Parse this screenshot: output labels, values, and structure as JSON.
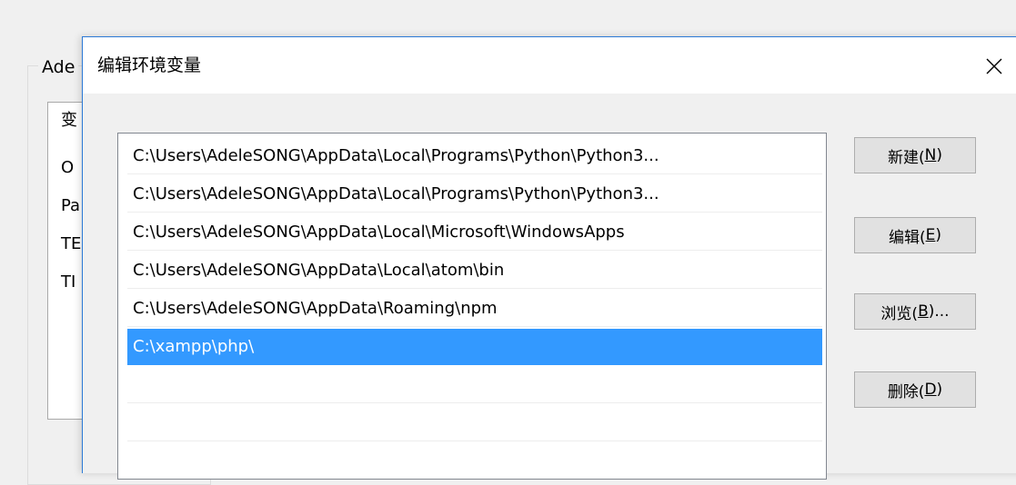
{
  "background": {
    "group_label": "Ade",
    "list_items": [
      "变",
      "O",
      "Pa",
      "TE",
      "TI"
    ]
  },
  "dialog": {
    "title": "编辑环境变量",
    "paths": [
      "C:\\Users\\AdeleSONG\\AppData\\Local\\Programs\\Python\\Python3...",
      "C:\\Users\\AdeleSONG\\AppData\\Local\\Programs\\Python\\Python3...",
      "C:\\Users\\AdeleSONG\\AppData\\Local\\Microsoft\\WindowsApps",
      "C:\\Users\\AdeleSONG\\AppData\\Local\\atom\\bin",
      "C:\\Users\\AdeleSONG\\AppData\\Roaming\\npm",
      "C:\\xampp\\php\\",
      "",
      ""
    ],
    "selected_index": 5,
    "buttons": {
      "new": {
        "label": "新建(",
        "key": "N",
        "suffix": ")"
      },
      "edit": {
        "label": "编辑(",
        "key": "E",
        "suffix": ")"
      },
      "browse": {
        "label": "浏览(",
        "key": "B",
        "suffix": ")..."
      },
      "delete": {
        "label": "删除(",
        "key": "D",
        "suffix": ")"
      }
    }
  },
  "colors": {
    "selection": "#3399ff",
    "accent_border": "#2b79d6"
  }
}
